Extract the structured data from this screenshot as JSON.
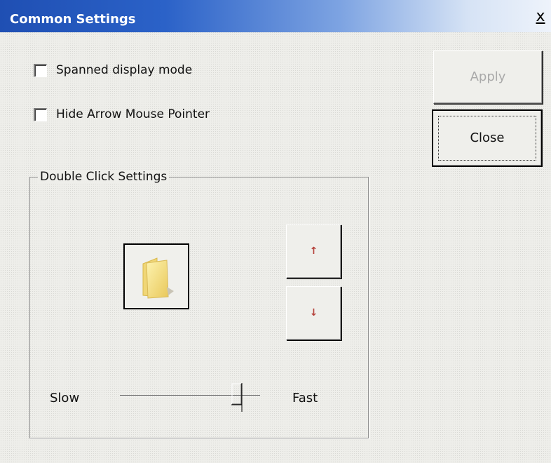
{
  "window": {
    "title": "Common Settings",
    "close_glyph": "x"
  },
  "options": {
    "spanned_display_mode": {
      "label": "Spanned display mode",
      "checked": false
    },
    "hide_arrow_pointer": {
      "label": "Hide Arrow Mouse Pointer",
      "checked": false
    }
  },
  "buttons": {
    "apply_label": "Apply",
    "apply_enabled": false,
    "close_label": "Close"
  },
  "double_click": {
    "group_title": "Double Click Settings",
    "test_icon": "folder-icon",
    "up_glyph": "↑",
    "down_glyph": "↓",
    "speed": {
      "slow_label": "Slow",
      "fast_label": "Fast",
      "value_fraction": 0.87
    }
  },
  "colors": {
    "title_bar_start": "#1f4fb3",
    "title_bar_end": "#eef3fb",
    "arrow_glyph": "#b5413a",
    "disabled_text": "#a9a9a9"
  }
}
